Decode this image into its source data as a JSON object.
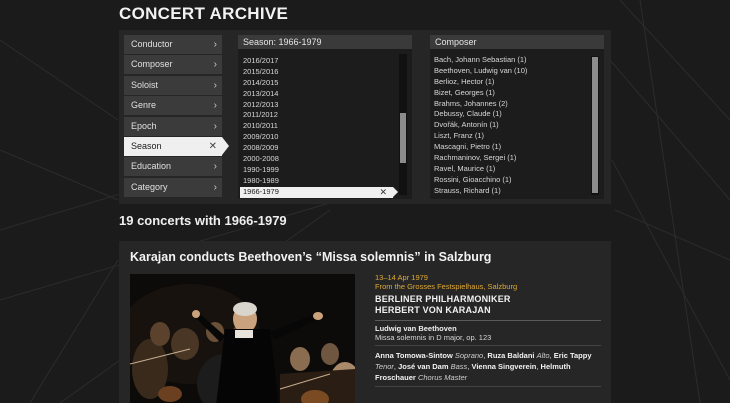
{
  "page": {
    "title": "CONCERT ARCHIVE"
  },
  "categories": [
    {
      "label": "Conductor",
      "icon": "chevron-right-icon",
      "active": false
    },
    {
      "label": "Composer",
      "icon": "chevron-right-icon",
      "active": false
    },
    {
      "label": "Soloist",
      "icon": "chevron-right-icon",
      "active": false
    },
    {
      "label": "Genre",
      "icon": "chevron-right-icon",
      "active": false
    },
    {
      "label": "Epoch",
      "icon": "chevron-right-icon",
      "active": false
    },
    {
      "label": "Season",
      "icon": "close-icon",
      "active": true
    },
    {
      "label": "Education",
      "icon": "chevron-right-icon",
      "active": false
    },
    {
      "label": "Category",
      "icon": "chevron-right-icon",
      "active": false
    }
  ],
  "season_filter": {
    "header": "Season: 1966-1979",
    "items": [
      "2016/2017",
      "2015/2016",
      "2014/2015",
      "2013/2014",
      "2012/2013",
      "2011/2012",
      "2010/2011",
      "2009/2010",
      "2008/2009",
      "2000-2008",
      "1990-1999",
      "1980-1989",
      "1966-1979"
    ],
    "selected": "1966-1979",
    "selected_icon": "close-icon",
    "scroll_position": 0.65
  },
  "composer_filter": {
    "header": "Composer",
    "items": [
      "Bach, Johann Sebastian (1)",
      "Beethoven, Ludwig van (10)",
      "Berlioz, Hector (1)",
      "Bizet, Georges (1)",
      "Brahms, Johannes (2)",
      "Debussy, Claude (1)",
      "Dvořák, Antonín (1)",
      "Liszt, Franz (1)",
      "Mascagni, Pietro (1)",
      "Rachmaninov, Sergei (1)",
      "Ravel, Maurice (1)",
      "Rossini, Gioacchino (1)",
      "Strauss, Richard (1)"
    ],
    "scroll_position": 0.0
  },
  "results": {
    "heading": "19 concerts with 1966-1979"
  },
  "concert": {
    "title": "Karajan conducts Beethoven’s “Missa solemnis” in Salzburg",
    "date": "13–14 Apr 1979",
    "venue": "From the Grosses Festspielhaus, Salzburg",
    "orchestra": "BERLINER PHILHARMONIKER",
    "conductor": "HERBERT VON KARAJAN",
    "composer": "Ludwig van Beethoven",
    "work": "Missa solemnis in D major, op. 123",
    "performers": [
      {
        "name": "Anna Tomowa-Sintow",
        "role": "Soprano"
      },
      {
        "name": "Ruza Baldani",
        "role": "Alto"
      },
      {
        "name": "Eric Tappy",
        "role": "Tenor"
      },
      {
        "name": "José van Dam",
        "role": "Bass"
      },
      {
        "name": "Vienna Singverein",
        "role": ""
      },
      {
        "name": "Helmuth Froschauer",
        "role": "Chorus Master"
      }
    ]
  },
  "colors": {
    "background": "#1b1b1b",
    "panel": "#262626",
    "accent": "#e0a934",
    "active_item": "#efefef"
  }
}
